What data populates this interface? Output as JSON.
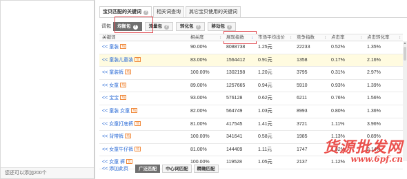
{
  "left_panel": {
    "footer_text": "您还可以添加200个"
  },
  "tabs": [
    {
      "label": "宝贝匹配的关键词",
      "active": true,
      "has_help": true
    },
    {
      "label": "相关词查询",
      "active": false,
      "has_help": false
    },
    {
      "label": "其它宝贝使用的关键词",
      "active": false,
      "has_help": false
    }
  ],
  "subtabs": {
    "prefix_label": "词包",
    "items": [
      {
        "label": "均衡包",
        "active": true,
        "has_help": true
      },
      {
        "label": "流量包",
        "active": false,
        "has_help": true
      },
      {
        "label": "转化包",
        "active": false,
        "has_help": true
      },
      {
        "label": "移动包",
        "active": false,
        "has_help": true
      }
    ]
  },
  "table": {
    "columns": [
      "关键词",
      "相关度",
      "展现指数",
      "市场平均出价",
      "竞争指数",
      "点击率",
      "点击转化率"
    ],
    "sorted_column": "展现指数",
    "rows": [
      {
        "kw": "童装",
        "badge": "热",
        "rel": "90.00%",
        "show": "8088738",
        "bid": "1.25元",
        "comp": "22233",
        "ctr": "0.52%",
        "cvr": "1.35%",
        "hl": false
      },
      {
        "kw": "童装儿童装",
        "badge": "优",
        "rel": "83.00%",
        "show": "1564412",
        "bid": "0.91元",
        "comp": "1358",
        "ctr": "0.17%",
        "cvr": "2.16%",
        "hl": true
      },
      {
        "kw": "童装裤",
        "badge": "热",
        "rel": "100.00%",
        "show": "1302198",
        "bid": "1.20元",
        "comp": "3795",
        "ctr": "0.31%",
        "cvr": "2.97%",
        "hl": false
      },
      {
        "kw": "女童",
        "badge": "热",
        "rel": "89.00%",
        "show": "1257665",
        "bid": "0.94元",
        "comp": "5910",
        "ctr": "0.93%",
        "cvr": "1.39%",
        "hl": false
      },
      {
        "kw": "宝宝",
        "badge": "热",
        "rel": "93.00%",
        "show": "576128",
        "bid": "0.62元",
        "comp": "6211",
        "ctr": "0.76%",
        "cvr": "1.56%",
        "hl": false
      },
      {
        "kw": "童装 女童",
        "badge": "热",
        "rel": "82.00%",
        "show": "564749",
        "bid": "1.03元",
        "comp": "8993",
        "ctr": "0.80%",
        "cvr": "1.36%",
        "hl": false
      },
      {
        "kw": "女童打底裤",
        "badge": "热",
        "rel": "81.00%",
        "show": "417545",
        "bid": "1.41元",
        "comp": "3721",
        "ctr": "1.11%",
        "cvr": "3.96%",
        "hl": false
      },
      {
        "kw": "背带裤",
        "badge": "热",
        "rel": "100.00%",
        "show": "341641",
        "bid": "0.58元",
        "comp": "1985",
        "ctr": "1.13%",
        "cvr": "0.89%",
        "hl": false
      },
      {
        "kw": "女童牛仔裤",
        "badge": "热",
        "rel": "81.00%",
        "show": "144409",
        "bid": "1.11元",
        "comp": "1747",
        "ctr": "1.32%",
        "cvr": "2.14%",
        "hl": false
      },
      {
        "kw": "女童 裤",
        "badge": "优",
        "rel": "100.00%",
        "show": "119528",
        "bid": "1.05元",
        "comp": "2137",
        "ctr": "1.12%",
        "cvr": "",
        "hl": false
      }
    ]
  },
  "bottom": {
    "add_link": "<< 添加此页",
    "match_buttons": [
      {
        "label": "广泛匹配",
        "active": true
      },
      {
        "label": "中心词匹配",
        "active": false
      },
      {
        "label": "精确匹配",
        "active": false
      }
    ]
  },
  "watermark": {
    "line1": "货源批发网",
    "line2": "www.6pf.cn"
  },
  "colors": {
    "link": "#2b6bd6",
    "highlight_box": "#e0484f",
    "badge": "#f08a3c",
    "row_highlight": "#fffbe0"
  }
}
